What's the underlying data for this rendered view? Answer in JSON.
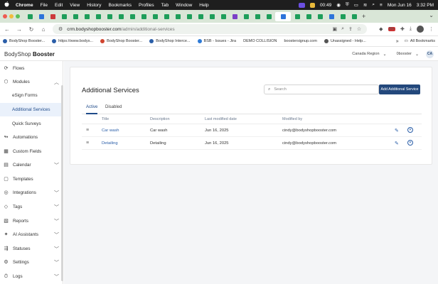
{
  "menubar": {
    "app": "Chrome",
    "items": [
      "File",
      "Edit",
      "View",
      "History",
      "Bookmarks",
      "Profiles",
      "Tab",
      "Window",
      "Help"
    ],
    "time": "00:49",
    "date": "Mon Jun 16",
    "clock": "3:32 PM"
  },
  "browser": {
    "tab_colors": [
      "#1d9e5a",
      "#2d74da",
      "#cc3a3a",
      "#1d9e5a",
      "#1d9e5a",
      "#1d9e5a",
      "#1d9e5a",
      "#1d9e5a",
      "#1d9e5a",
      "#1d9e5a",
      "#1d9e5a",
      "#1d9e5a",
      "#1d9e5a",
      "#1d9e5a",
      "#1d9e5a",
      "#1d9e5a",
      "#1d9e5a",
      "#1d9e5a",
      "#7b3fc7",
      "#1d9e5a",
      "#1d9e5a",
      "#1d9e5a",
      "#2d74da",
      "#1d9e5a",
      "#1d9e5a",
      "#1d9e5a",
      "#2d74da",
      "#1d9e5a",
      "#1d9e5a"
    ],
    "tab_plus": "+",
    "url_host": "crm.bodyshopbooster.com",
    "url_path": "/admin/additional-services",
    "ext_badge": "29+"
  },
  "bookmarks": {
    "items": [
      "BodyShop Booster...",
      "https://www.bodys...",
      "BodyShop Booster...",
      "BodyShop Interce...",
      "BSB - Issues - Jira",
      "DEMO COLLISION",
      "boostersignup.com",
      "Unassigned - Help..."
    ],
    "more": "»",
    "all": "All Bookmarks"
  },
  "header": {
    "logo_prefix": "BodyShop",
    "logo_bold": "Booster",
    "region": "Canada Region",
    "account": "0booster",
    "avatar": "CA"
  },
  "sidebar": {
    "items": [
      {
        "label": "Flows",
        "icon": "flows-icon"
      },
      {
        "label": "Modules",
        "icon": "modules-icon",
        "chevron": "up"
      },
      {
        "label": "eSign Forms"
      },
      {
        "label": "Additional Services",
        "selected": true
      },
      {
        "label": "Quick Surveys"
      },
      {
        "label": "Automations",
        "icon": "automations-icon"
      },
      {
        "label": "Custom Fields",
        "icon": "custom-fields-icon"
      },
      {
        "label": "Calendar",
        "icon": "calendar-icon",
        "chevron": "down"
      },
      {
        "label": "Templates",
        "icon": "templates-icon"
      },
      {
        "label": "Integrations",
        "icon": "integrations-icon",
        "chevron": "down"
      },
      {
        "label": "Tags",
        "icon": "tags-icon",
        "chevron": "down"
      },
      {
        "label": "Reports",
        "icon": "reports-icon",
        "chevron": "down"
      },
      {
        "label": "AI Assistants",
        "icon": "ai-assistants-icon",
        "chevron": "down"
      },
      {
        "label": "Statuses",
        "icon": "statuses-icon",
        "chevron": "down"
      },
      {
        "label": "Settings",
        "icon": "settings-icon",
        "chevron": "down"
      },
      {
        "label": "Logs",
        "icon": "logs-icon",
        "chevron": "down"
      }
    ]
  },
  "main": {
    "title": "Additional Services",
    "search_placeholder": "Search",
    "add_button": "Add Additional Service",
    "tabs": [
      "Active",
      "Disabled"
    ],
    "columns": [
      "Title",
      "Description",
      "Last modified date",
      "Modified by"
    ],
    "rows": [
      {
        "title": "Car wash",
        "description": "Car wash",
        "date": "Jun 16, 2025",
        "by": "cindy@bodyshopbooster.com"
      },
      {
        "title": "Detailing",
        "description": "Detailing",
        "date": "Jun 16, 2025",
        "by": "cindy@bodyshopbooster.com"
      }
    ]
  },
  "colors": {
    "accent": "#23487c",
    "link": "#2a5ea8",
    "tabstrip": "#d9e6d7"
  }
}
